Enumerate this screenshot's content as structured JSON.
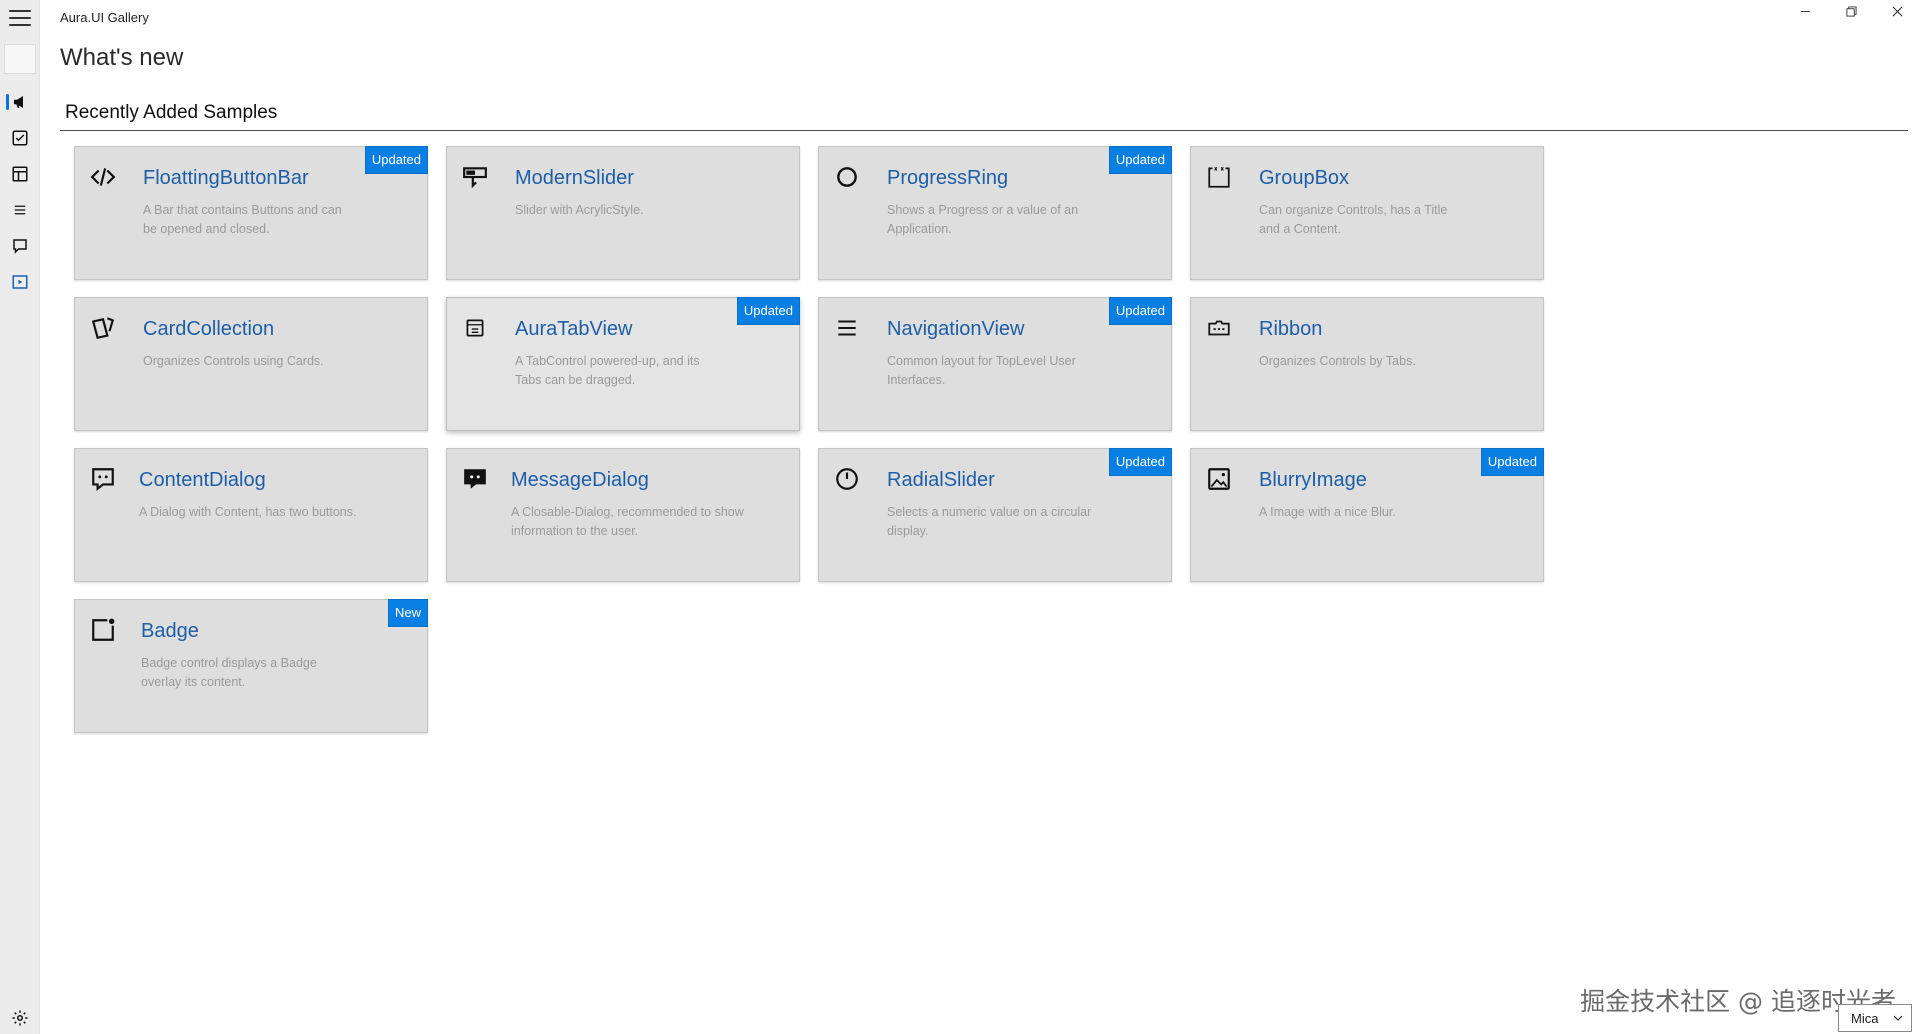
{
  "window": {
    "title": "Aura.UI Gallery",
    "controls": {
      "minimize": "—",
      "maximize": "❐",
      "close": "✕"
    }
  },
  "page": {
    "title": "What's new",
    "section_title": "Recently Added Samples"
  },
  "sidebar": {
    "items": [
      {
        "icon": "megaphone-icon",
        "selected": true
      },
      {
        "icon": "checkbox-icon",
        "selected": false
      },
      {
        "icon": "layout-icon",
        "selected": false
      },
      {
        "icon": "list-icon",
        "selected": false
      },
      {
        "icon": "chat-icon",
        "selected": false
      },
      {
        "icon": "media-icon",
        "selected": false
      }
    ],
    "settings_icon": "gear-icon"
  },
  "cards": [
    {
      "title": "FloattingButtonBar",
      "description": "A Bar that contains Buttons and can be opened and closed.",
      "badge": "Updated",
      "icon": "code-icon"
    },
    {
      "title": "ModernSlider",
      "description": "Slider with AcrylicStyle.",
      "badge": "",
      "icon": "slider-icon"
    },
    {
      "title": "ProgressRing",
      "description": "Shows a Progress or a value of an Application.",
      "badge": "Updated",
      "icon": "ring-icon"
    },
    {
      "title": "GroupBox",
      "description": "Can organize Controls, has a Title and a Content.",
      "badge": "",
      "icon": "groupbox-icon"
    },
    {
      "title": "CardCollection",
      "description": "Organizes Controls using Cards.",
      "badge": "",
      "icon": "cards-icon"
    },
    {
      "title": "AuraTabView",
      "description": "A TabControl powered-up, and its Tabs can be dragged.",
      "badge": "Updated",
      "icon": "tabview-icon"
    },
    {
      "title": "NavigationView",
      "description": "Common layout for TopLevel User Interfaces.",
      "badge": "Updated",
      "icon": "navigation-icon"
    },
    {
      "title": "Ribbon",
      "description": "Organizes Controls by Tabs.",
      "badge": "",
      "icon": "ribbon-icon"
    },
    {
      "title": "ContentDialog",
      "description": "A Dialog with Content, has two buttons.",
      "badge": "",
      "icon": "dialog-icon"
    },
    {
      "title": "MessageDialog",
      "description": "A Closable-Dialog, recommended to show information to the user.",
      "badge": "",
      "icon": "message-icon"
    },
    {
      "title": "RadialSlider",
      "description": "Selects a numeric value on a circular display.",
      "badge": "Updated",
      "icon": "radial-icon"
    },
    {
      "title": "BlurryImage",
      "description": "A Image with a nice Blur.",
      "badge": "Updated",
      "icon": "image-icon"
    },
    {
      "title": "Badge",
      "description": "Badge control displays a Badge overlay its content.",
      "badge": "New",
      "icon": "badge-icon"
    }
  ],
  "footer": {
    "watermark": "掘金技术社区 @ 追逐时光者",
    "theme_select_value": "Mica"
  },
  "colors": {
    "accent": "#0a7fe3",
    "card_title": "#1d5ea8",
    "card_bg": "#dedede",
    "sidebar_bg": "#ececec"
  }
}
